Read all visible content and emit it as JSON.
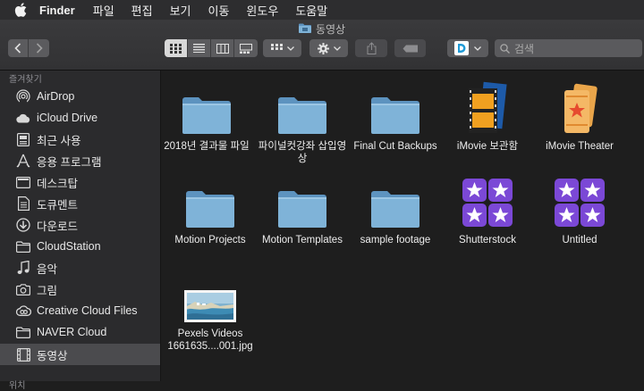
{
  "menubar": {
    "app": "Finder",
    "menus": [
      "파일",
      "편집",
      "보기",
      "이동",
      "윈도우",
      "도움말"
    ]
  },
  "window": {
    "title": "동영상"
  },
  "search": {
    "placeholder": "검색"
  },
  "sidebar": {
    "section_favorites": "즐겨찾기",
    "items": [
      {
        "label": "AirDrop",
        "icon": "airdrop-icon"
      },
      {
        "label": "iCloud Drive",
        "icon": "cloud-icon"
      },
      {
        "label": "최근 사용",
        "icon": "recents-icon"
      },
      {
        "label": "응용 프로그램",
        "icon": "applications-icon"
      },
      {
        "label": "데스크탑",
        "icon": "desktop-icon"
      },
      {
        "label": "도큐멘트",
        "icon": "document-icon"
      },
      {
        "label": "다운로드",
        "icon": "download-icon"
      },
      {
        "label": "CloudStation",
        "icon": "folder-icon"
      },
      {
        "label": "음악",
        "icon": "music-icon"
      },
      {
        "label": "그림",
        "icon": "camera-icon"
      },
      {
        "label": "Creative Cloud Files",
        "icon": "creative-cloud-icon"
      },
      {
        "label": "NAVER Cloud",
        "icon": "folder-icon"
      },
      {
        "label": "동영상",
        "icon": "film-icon",
        "selected": true
      }
    ],
    "section_icloud": "위치"
  },
  "files": [
    {
      "label": "2018년 결과물 파일",
      "type": "folder"
    },
    {
      "label": "파이널컷강좌 삽입영상",
      "type": "folder"
    },
    {
      "label": "Final Cut Backups",
      "type": "folder"
    },
    {
      "label": "iMovie 보관함",
      "type": "imovie-library"
    },
    {
      "label": "iMovie Theater",
      "type": "imovie-theater"
    },
    {
      "label": "Motion Projects",
      "type": "folder"
    },
    {
      "label": "Motion Templates",
      "type": "folder"
    },
    {
      "label": "sample footage",
      "type": "folder"
    },
    {
      "label": "Shutterstock",
      "type": "stars"
    },
    {
      "label": "Untitled",
      "type": "stars"
    },
    {
      "label": "Pexels Videos 1661635....001.jpg",
      "type": "image"
    }
  ],
  "colors": {
    "folder": "#7fb3d8",
    "folder_dark": "#5d93bf",
    "selected": "#4b4b4e",
    "stars_bg": "#7b48d6"
  }
}
